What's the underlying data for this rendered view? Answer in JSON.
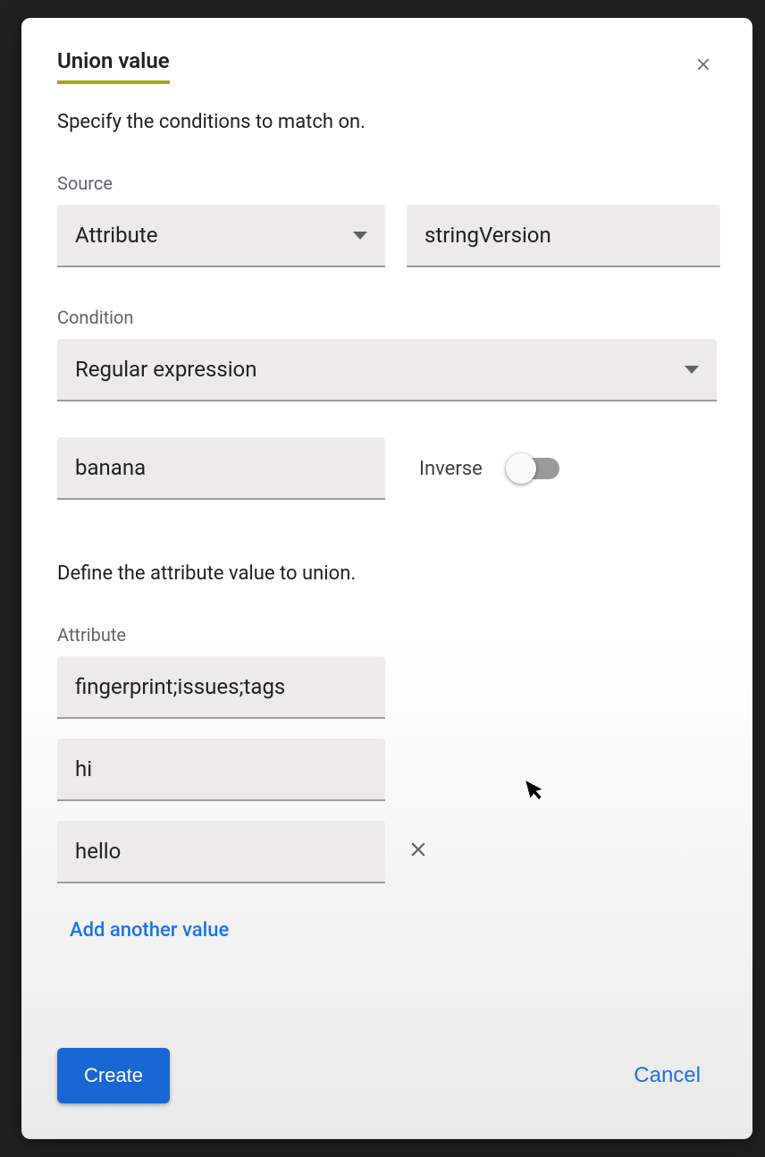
{
  "dialog": {
    "title": "Union value",
    "description": "Specify the conditions to match on.",
    "source_label": "Source",
    "source_type": "Attribute",
    "source_value": "stringVersion",
    "condition_label": "Condition",
    "condition_value": "Regular expression",
    "regex_value": "banana",
    "inverse_label": "Inverse",
    "inverse_on": false,
    "union_description": "Define the attribute value to union.",
    "attribute_label": "Attribute",
    "attribute_values": [
      "fingerprint;issues;tags",
      "hi",
      "hello"
    ],
    "add_value_label": "Add another value",
    "create_label": "Create",
    "cancel_label": "Cancel"
  }
}
